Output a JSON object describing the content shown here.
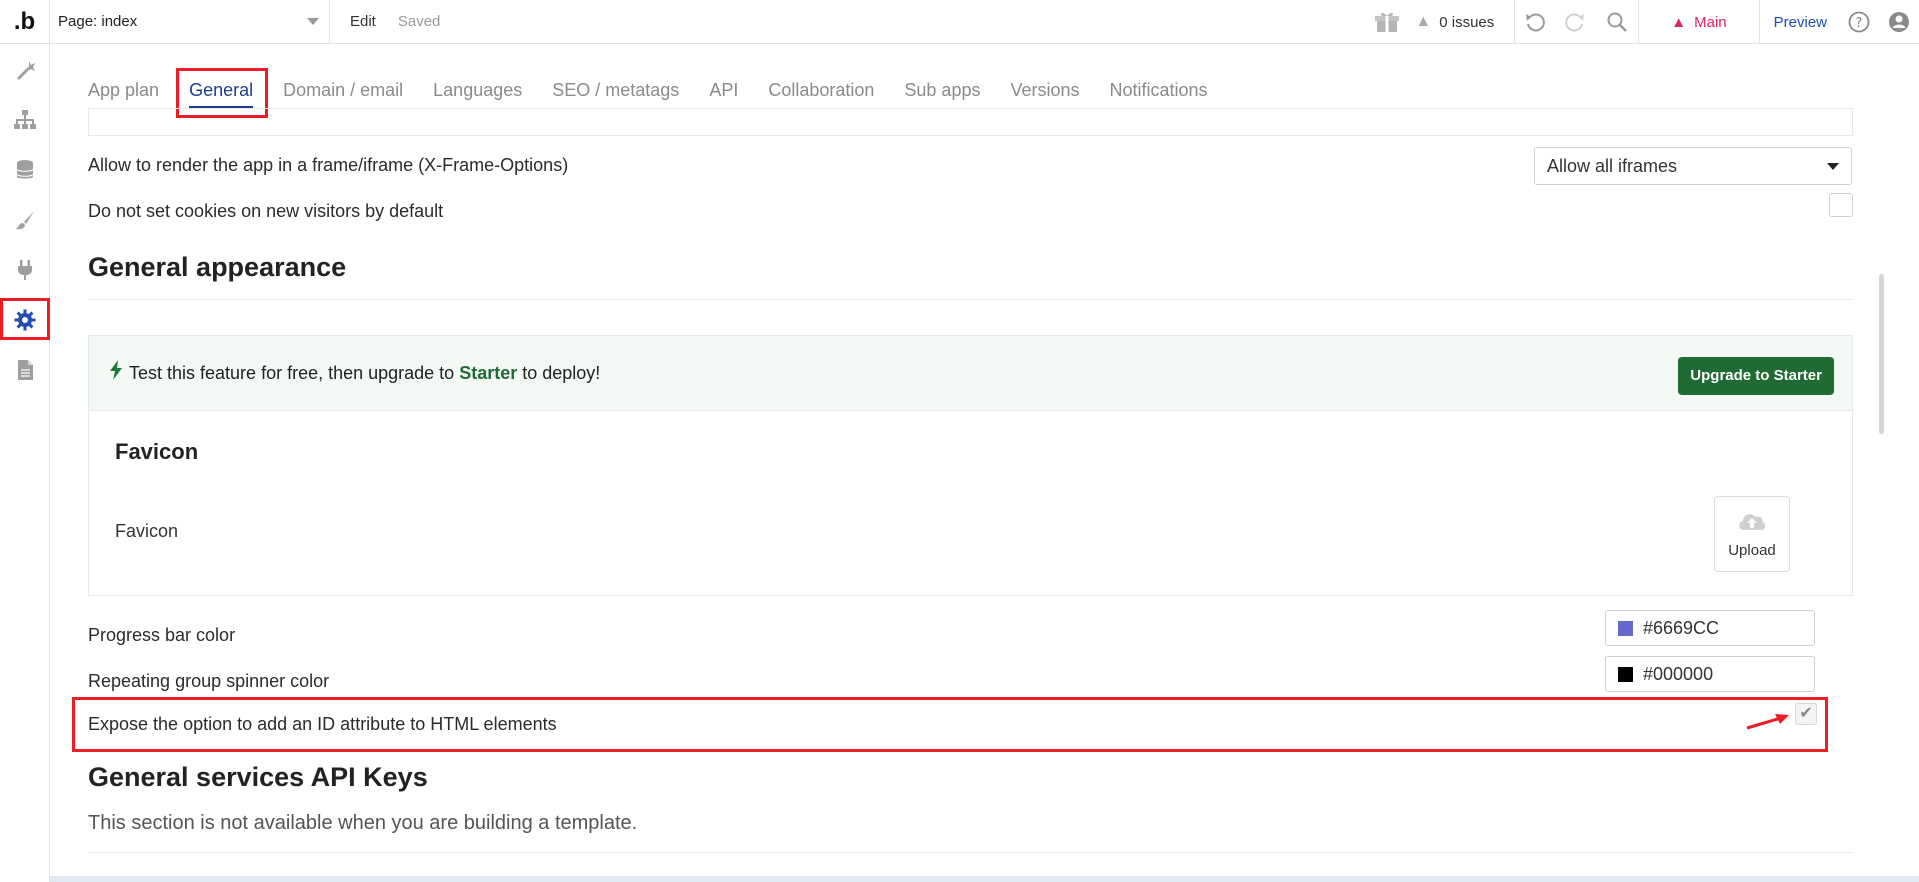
{
  "topbar": {
    "logo": ".b",
    "page_select": "Page: index",
    "edit": "Edit",
    "saved": "Saved",
    "issues": "0 issues",
    "branch": "Main",
    "preview": "Preview"
  },
  "tabs": [
    {
      "label": "App plan"
    },
    {
      "label": "General"
    },
    {
      "label": "Domain / email"
    },
    {
      "label": "Languages"
    },
    {
      "label": "SEO / metatags"
    },
    {
      "label": "API"
    },
    {
      "label": "Collaboration"
    },
    {
      "label": "Sub apps"
    },
    {
      "label": "Versions"
    },
    {
      "label": "Notifications"
    }
  ],
  "settings": {
    "iframe_label": "Allow to render the app in a frame/iframe (X-Frame-Options)",
    "iframe_value": "Allow all iframes",
    "cookies_label": "Do not set cookies on new visitors by default"
  },
  "appearance": {
    "title": "General appearance",
    "banner_prefix": "Test this feature for free, then upgrade to",
    "banner_plan": "Starter",
    "banner_suffix": "to deploy!",
    "upgrade_button": "Upgrade to Starter",
    "favicon_title": "Favicon",
    "favicon_label": "Favicon",
    "upload": "Upload",
    "progress_label": "Progress bar color",
    "progress_value": "#6669CC",
    "spinner_label": "Repeating group spinner color",
    "spinner_value": "#000000",
    "expose_id_label": "Expose the option to add an ID attribute to HTML elements"
  },
  "api_keys": {
    "title": "General services API Keys",
    "note": "This section is not available when you are building a template."
  },
  "colors": {
    "accent": "#1e3d8f",
    "highlight": "#ee1c25",
    "upgrade": "#1f6b33",
    "progress_swatch": "#6669CC",
    "spinner_swatch": "#000000"
  }
}
